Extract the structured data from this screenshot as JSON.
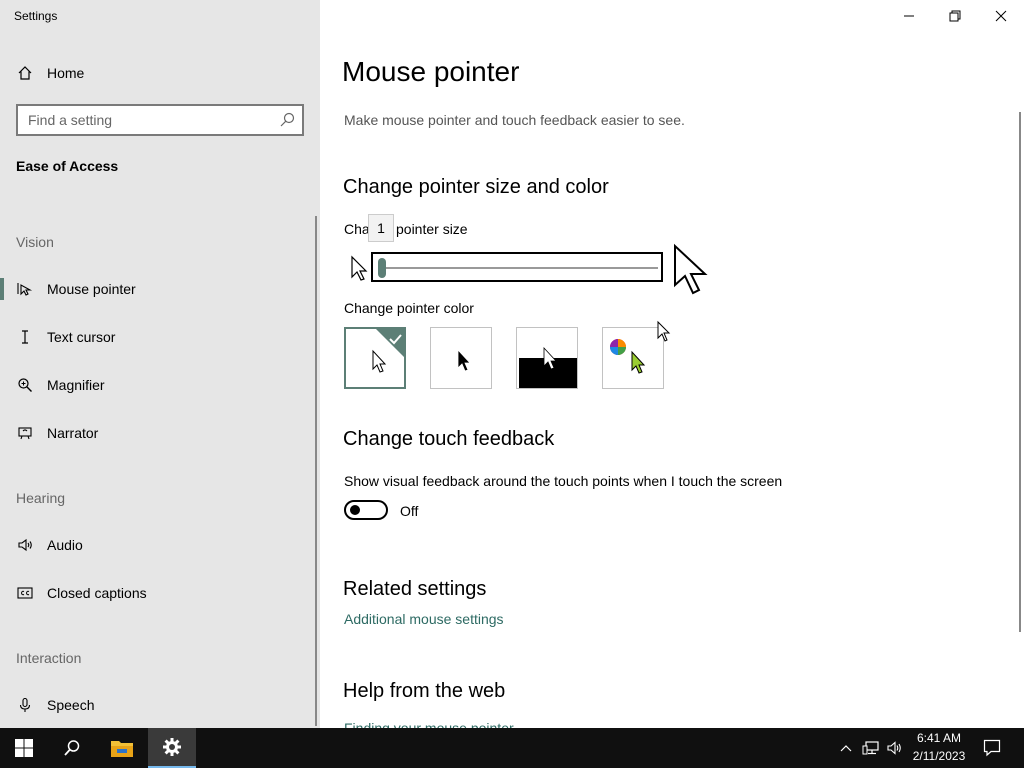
{
  "app": {
    "title": "Settings"
  },
  "sidebar": {
    "home": "Home",
    "search_placeholder": "Find a setting",
    "category": "Ease of Access",
    "sections": {
      "vision": "Vision",
      "hearing": "Hearing",
      "interaction": "Interaction"
    },
    "items": {
      "mouse_pointer": "Mouse pointer",
      "text_cursor": "Text cursor",
      "magnifier": "Magnifier",
      "narrator": "Narrator",
      "audio": "Audio",
      "closed_captions": "Closed captions",
      "speech": "Speech"
    }
  },
  "main": {
    "title": "Mouse pointer",
    "subtitle": "Make mouse pointer and touch feedback easier to see.",
    "size_color_heading": "Change pointer size and color",
    "size_label_left": "Cha",
    "size_label_right": "pointer size",
    "size_tooltip": "1",
    "size_value": 1,
    "size_range": [
      1,
      15
    ],
    "color_label": "Change pointer color",
    "color_options": [
      "white",
      "black",
      "inverted",
      "custom"
    ],
    "selected_color": "white",
    "touch_heading": "Change touch feedback",
    "touch_label": "Show visual feedback around the touch points when I touch the screen",
    "touch_state": "Off",
    "related_heading": "Related settings",
    "related_link": "Additional mouse settings",
    "help_heading": "Help from the web",
    "help_link": "Finding your mouse pointer"
  },
  "taskbar": {
    "time": "6:41 AM",
    "date": "2/11/2023",
    "icons": [
      "windows-start-icon",
      "search-icon",
      "file-explorer-icon",
      "settings-icon",
      "chevron-up-icon",
      "network-icon",
      "volume-icon",
      "notification-icon"
    ]
  },
  "colors": {
    "accent": "#5c7f76",
    "link": "#2d6a63",
    "sidebar_bg": "#e6e6e6",
    "taskbar_bg": "#101010"
  }
}
